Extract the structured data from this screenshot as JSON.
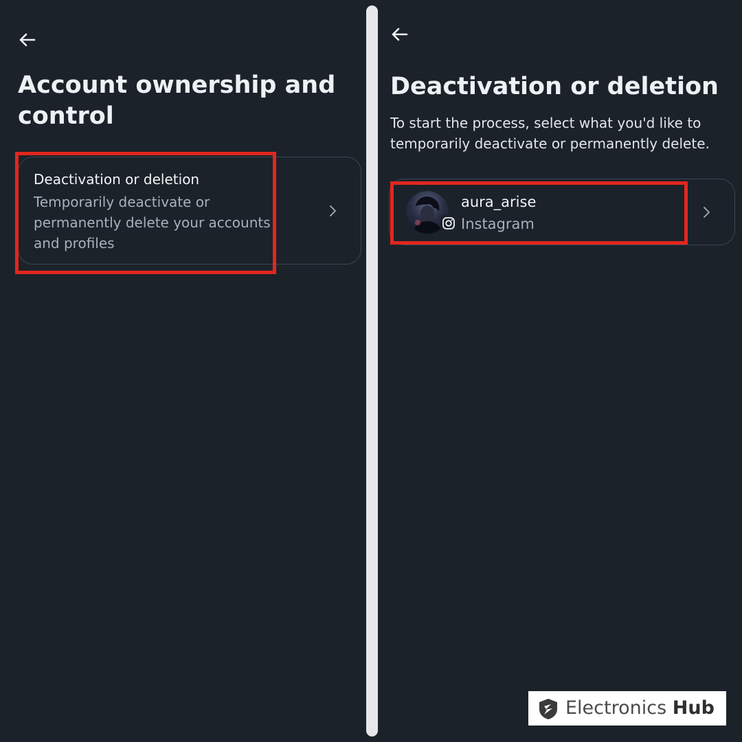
{
  "left_screen": {
    "title": "Account ownership and control",
    "option": {
      "heading": "Deactivation or deletion",
      "description": "Temporarily deactivate or permanently delete your accounts and profiles"
    }
  },
  "right_screen": {
    "title": "Deactivation or deletion",
    "subtitle": "To start the process, select what you'd like to temporarily deactivate or permanently delete.",
    "account": {
      "username": "aura_arise",
      "platform": "Instagram"
    }
  },
  "watermark": {
    "text_regular": "Electronics ",
    "text_bold": "Hub"
  },
  "colors": {
    "background": "#1b222a",
    "highlight": "#e3261f",
    "card_border": "#3c4853",
    "secondary_text": "#a7b1bb"
  },
  "icons": {
    "back": "arrow-left-icon",
    "chevron": "chevron-right-icon",
    "instagram": "instagram-icon"
  }
}
